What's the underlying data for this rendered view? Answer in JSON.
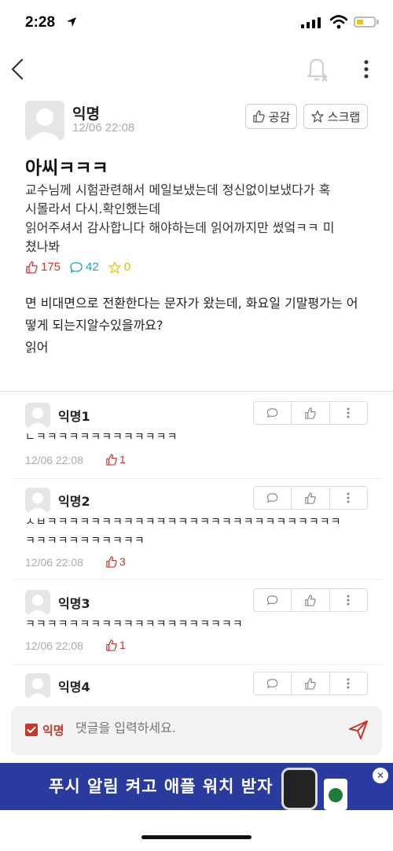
{
  "status": {
    "time": "2:28"
  },
  "post": {
    "author": "익명",
    "date": "12/06 22:08",
    "like_button": "공감",
    "scrap_button": "스크랩",
    "title": "아씨ㅋㅋㅋ",
    "body": "교수님께 시험관련해서 메일보냈는데 정신없이보냈다가 혹\n시몰라서 다시.확인했는데\n읽어주셔서 감사합니다 해야하는데 읽어까지만 썼엌ㅋㅋ 미\n쳤나봐",
    "likes": "175",
    "comments": "42",
    "scraps": "0",
    "quote": "면 비대면으로 전환한다는 문자가 왔는데, 화요일 기말평가는 어\n떻게 되는지알수있을까요?\n읽어"
  },
  "comments": [
    {
      "author": "익명1",
      "text": "ㄴㅋㅋㅋㅋㅋㅋㅋㅋㅋㅋㅋㅋㅋ",
      "date": "12/06 22:08",
      "likes": "1"
    },
    {
      "author": "익명2",
      "text": "ㅅㅂㅋㅋㅋㅋㅋㅋㅋㅋㅋㅋㅋㅋㅋㅋㅋㅋㅋㅋㅋㅋㅋㅋㅋㅋㅋㅋㅋ\nㅋㅋㅋㅋㅋㅋㅋㅋㅋㅋㅋ",
      "date": "12/06 22:08",
      "likes": "3"
    },
    {
      "author": "익명3",
      "text": "ㅋㅋㅋㅋㅋㅋㅋㅋㅋㅋㅋㅋㅋㅋㅋㅋㅋㅋㅋㅋ",
      "date": "12/06 22:08",
      "likes": "1"
    },
    {
      "author": "익명4"
    }
  ],
  "comment_input": {
    "anon_label": "익명",
    "placeholder": "댓글을 입력하세요."
  },
  "banner": {
    "text": "푸시 알림 켜고 애플 워치 받자"
  },
  "colors": {
    "accent": "#c0392b",
    "comment_icon": "#17a2b8",
    "scrap_icon": "#f1c40f",
    "banner_bg": "#2b3a9e"
  }
}
